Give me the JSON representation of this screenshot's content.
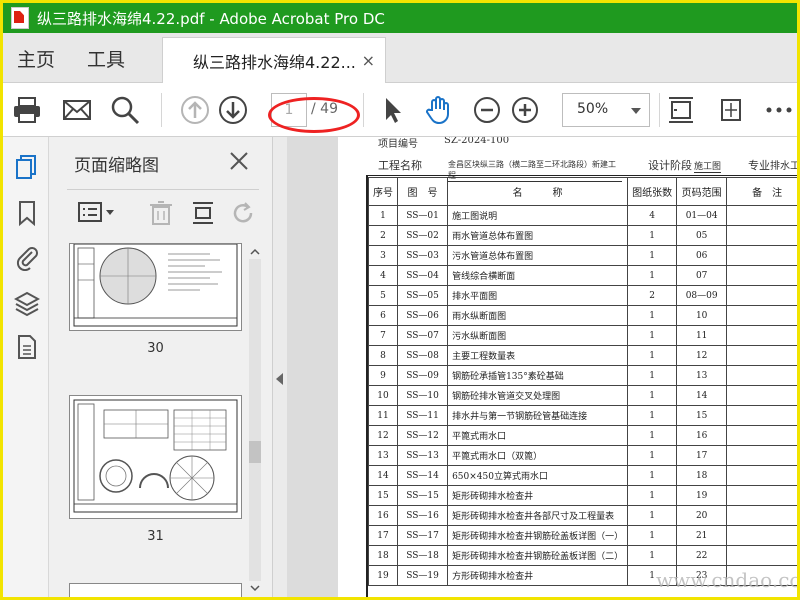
{
  "window": {
    "title": "纵三路排水海绵4.22.pdf - Adobe Acrobat Pro DC"
  },
  "nav_tabs": [
    {
      "label": "主页"
    },
    {
      "label": "工具"
    }
  ],
  "doc_tab": {
    "label": "纵三路排水海绵4.22...",
    "close": "×"
  },
  "toolbar": {
    "page_current": "1",
    "page_total": "/ 49",
    "zoom": "50%"
  },
  "panel": {
    "title": "页面缩略图",
    "thumbnails": [
      {
        "number": "30"
      },
      {
        "number": "31"
      }
    ]
  },
  "document": {
    "project_no_label": "项目编号",
    "project_no": "SZ-2024-100",
    "project_name_label": "工程名称",
    "project_name": "金昌区块纵三路（横二路至二环北路段）新建工程",
    "design_stage_label": "设计阶段",
    "design_stage": "施工图",
    "major_label": "专业",
    "major": "排水工",
    "headers": {
      "seq": "序号",
      "no": "图　号",
      "name": "名　　　称",
      "count": "图纸张数",
      "range": "页码范围",
      "note": "备　注"
    },
    "rows": [
      {
        "seq": "1",
        "no": "SS—01",
        "name": "施工图说明",
        "count": "4",
        "range": "01—04"
      },
      {
        "seq": "2",
        "no": "SS—02",
        "name": "雨水管道总体布置图",
        "count": "1",
        "range": "05"
      },
      {
        "seq": "3",
        "no": "SS—03",
        "name": "污水管道总体布置图",
        "count": "1",
        "range": "06"
      },
      {
        "seq": "4",
        "no": "SS—04",
        "name": "管线综合横断面",
        "count": "1",
        "range": "07"
      },
      {
        "seq": "5",
        "no": "SS—05",
        "name": "排水平面图",
        "count": "2",
        "range": "08—09"
      },
      {
        "seq": "6",
        "no": "SS—06",
        "name": "雨水纵断面图",
        "count": "1",
        "range": "10"
      },
      {
        "seq": "7",
        "no": "SS—07",
        "name": "污水纵断面图",
        "count": "1",
        "range": "11"
      },
      {
        "seq": "8",
        "no": "SS—08",
        "name": "主要工程数量表",
        "count": "1",
        "range": "12"
      },
      {
        "seq": "9",
        "no": "SS—09",
        "name": "钢筋砼承插管135°素砼基础",
        "count": "1",
        "range": "13"
      },
      {
        "seq": "10",
        "no": "SS—10",
        "name": "钢筋砼排水管道交叉处理图",
        "count": "1",
        "range": "14"
      },
      {
        "seq": "11",
        "no": "SS—11",
        "name": "排水井与第一节钢筋砼管基础连接",
        "count": "1",
        "range": "15"
      },
      {
        "seq": "12",
        "no": "SS—12",
        "name": "平篦式雨水口",
        "count": "1",
        "range": "16"
      },
      {
        "seq": "13",
        "no": "SS—13",
        "name": "平篦式雨水口（双篦）",
        "count": "1",
        "range": "17"
      },
      {
        "seq": "14",
        "no": "SS—14",
        "name": "650×450立箅式雨水口",
        "count": "1",
        "range": "18"
      },
      {
        "seq": "15",
        "no": "SS—15",
        "name": "矩形砖砌排水检查井",
        "count": "1",
        "range": "19"
      },
      {
        "seq": "16",
        "no": "SS—16",
        "name": "矩形砖砌排水检查井各部尺寸及工程量表",
        "count": "1",
        "range": "20"
      },
      {
        "seq": "17",
        "no": "SS—17",
        "name": "矩形砖砌排水检查井钢筋砼盖板详图（一）",
        "count": "1",
        "range": "21"
      },
      {
        "seq": "18",
        "no": "SS—18",
        "name": "矩形砖砌排水检查井钢筋砼盖板详图（二）",
        "count": "1",
        "range": "22"
      },
      {
        "seq": "19",
        "no": "SS—19",
        "name": "方形砖砌排水检查井",
        "count": "1",
        "range": "23"
      }
    ]
  },
  "watermark": "www.cndao.com",
  "colors": {
    "titlebar": "#1f9a1f",
    "accent": "#1a73c8",
    "frame": "#f2e400",
    "annotation": "#e22222"
  }
}
